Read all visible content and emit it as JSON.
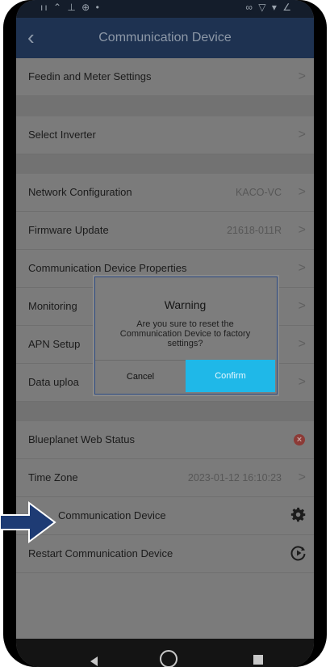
{
  "status_bar": {
    "left_icons": "ıı ⌃ ⊥ ⊕ •",
    "right_icons": "∞ ▽ ▾ ∠"
  },
  "header": {
    "title": "Communication Device",
    "back_icon": "chevron-left-icon"
  },
  "rows": {
    "feedin": {
      "label": "Feedin and Meter Settings"
    },
    "select_inverter": {
      "label": "Select Inverter"
    },
    "network": {
      "label": "Network Configuration",
      "value": "KACO-VC"
    },
    "firmware": {
      "label": "Firmware Update",
      "value": "21618-011R"
    },
    "properties": {
      "label": "Communication Device Properties"
    },
    "monitoring": {
      "label": "Monitoring"
    },
    "apn": {
      "label": "APN Setup"
    },
    "data_upload": {
      "label": "Data uploa"
    },
    "blueplanet": {
      "label": "Blueplanet Web Status"
    },
    "timezone": {
      "label": "Time Zone",
      "value": "2023-01-12 16:10:23"
    },
    "reset": {
      "label": "Communication Device"
    },
    "restart": {
      "label": "Restart Communication Device"
    }
  },
  "chevron": ">",
  "dialog": {
    "title": "Warning",
    "message": "Are you sure to reset the Communication Device to factory settings?",
    "cancel_label": "Cancel",
    "confirm_label": "Confirm"
  },
  "colors": {
    "appbar": "#1e3251",
    "confirm": "#1fb8e8",
    "error": "#8c3a36",
    "arrow": "#1e3b74"
  }
}
